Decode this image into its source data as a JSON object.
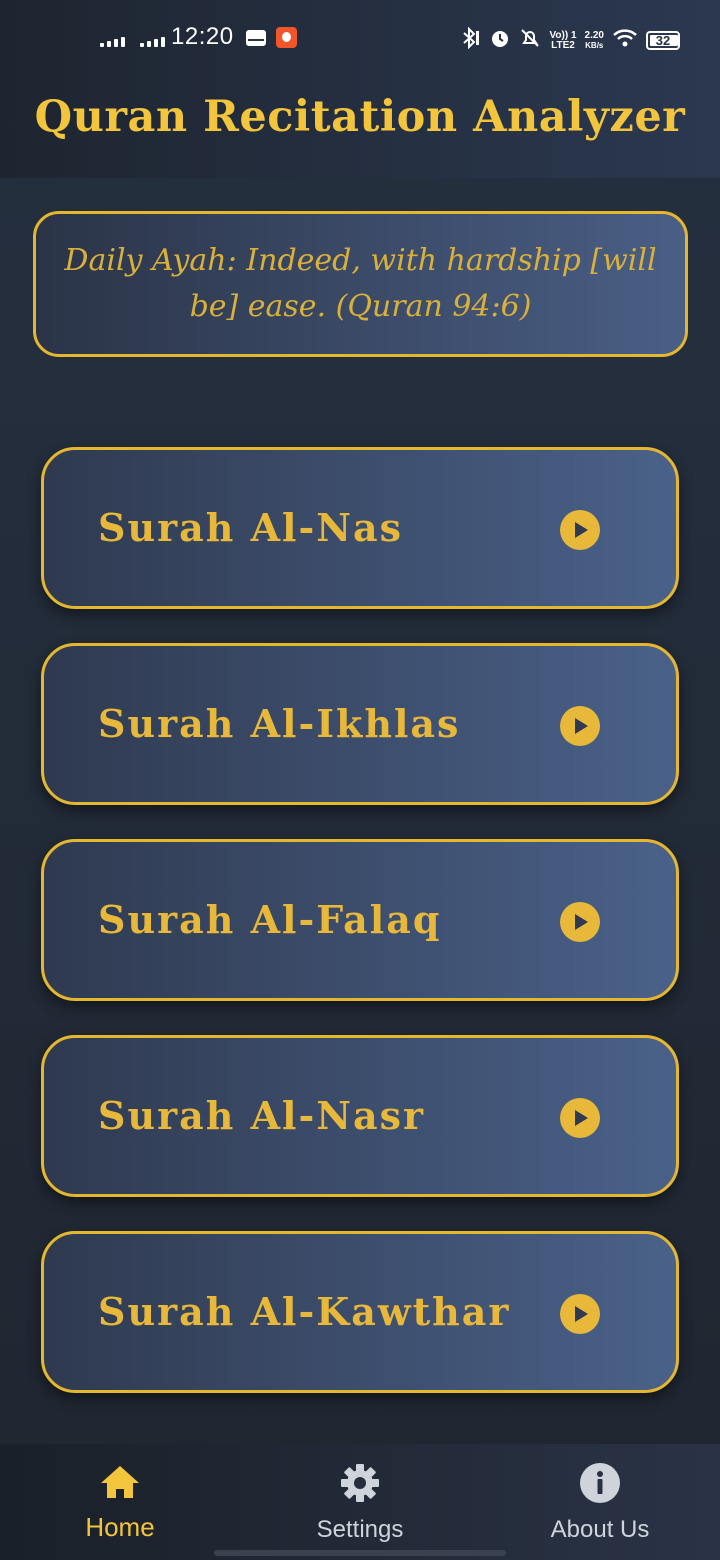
{
  "status_bar": {
    "time": "12:20",
    "volte": "Vo)) 1",
    "lte": "LTE2",
    "speed": "2.20",
    "speed_unit": "KB/s",
    "battery": "32"
  },
  "header": {
    "title": "Quran Recitation Analyzer"
  },
  "daily_ayah": {
    "text": "Daily Ayah: Indeed, with hardship [will be] ease. (Quran 94:6)"
  },
  "surahs": [
    {
      "label": "Surah Al-Nas"
    },
    {
      "label": "Surah Al-Ikhlas"
    },
    {
      "label": "Surah Al-Falaq"
    },
    {
      "label": "Surah Al-Nasr"
    },
    {
      "label": "Surah Al-Kawthar"
    }
  ],
  "bottom_nav": [
    {
      "label": "Home",
      "icon": "home-icon",
      "active": true
    },
    {
      "label": "Settings",
      "icon": "gear-icon",
      "active": false
    },
    {
      "label": "About Us",
      "icon": "info-icon",
      "active": false
    }
  ],
  "colors": {
    "accent": "#e8b83a",
    "active_tab": "#f2c53d",
    "inactive_tab": "#cfd3da",
    "card_start": "#2f3a50",
    "card_end": "#4a6189"
  }
}
